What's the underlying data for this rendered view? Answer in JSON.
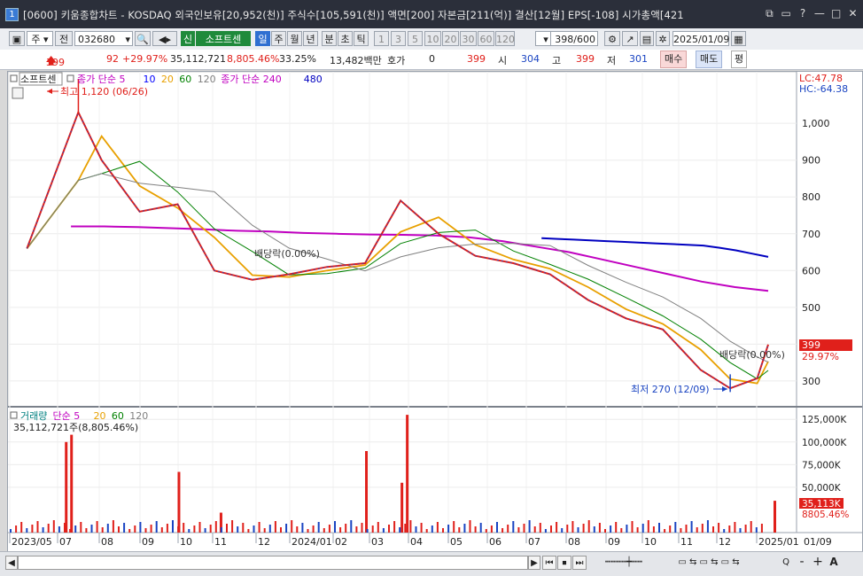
{
  "window": {
    "title": "[0600] 키움종합차트 - KOSDAQ 외국인보유[20,952(천)] 주식수[105,591(천)] 액면[200] 자본금[211(억)] 결산[12월] EPS[-108] 시가총액[421",
    "app_icon": "1"
  },
  "toolbar": {
    "period_label": "주",
    "prev_label": "전",
    "code": "032680",
    "badge": "신",
    "stock_name": "소프트센",
    "tabs": [
      "일",
      "주",
      "월",
      "년"
    ],
    "active_tab": "일",
    "intraday": [
      "분",
      "초",
      "틱"
    ],
    "intervals": [
      "1",
      "3",
      "5",
      "10",
      "20",
      "30",
      "60",
      "120"
    ],
    "bar_count": "398",
    "bar_total": "/600",
    "date": "2025/01/09"
  },
  "quote": {
    "price": "399",
    "change": "92",
    "change_pct": "+29.97%",
    "volume": "35,112,721",
    "vol_pct": "8,805.46%",
    "turnover_pct": "33.25%",
    "amount": "13,482백만",
    "hoga_label": "호가",
    "hoga_value": "0",
    "hoga_price": "399",
    "open_label": "시",
    "open": "304",
    "high_label": "고",
    "high": "399",
    "low_label": "저",
    "low": "301",
    "buy_label": "매수",
    "sell_label": "매도",
    "flat_label": "평"
  },
  "price_panel": {
    "stock_tag": "소프트센",
    "legend": [
      {
        "text": "종가 단순 5",
        "color": "#c000c0"
      },
      {
        "text": "10",
        "color": "#0000ff"
      },
      {
        "text": "20",
        "color": "#e8a000"
      },
      {
        "text": "60",
        "color": "#008000"
      },
      {
        "text": "120",
        "color": "#808080"
      },
      {
        "text": "종가 단순 240",
        "color": "#c000c0"
      },
      {
        "text": "480",
        "color": "#0000c0"
      }
    ],
    "lc_label": "LC:47.78",
    "hc_label": "HC:-64.38",
    "max_annotation": "최고 1,120 (06/26)",
    "min_annotation": "최저 270 (12/09)",
    "dividend_label_1": "배당락(0.00%)",
    "dividend_label_2": "배당락(0.00%)",
    "last_price_tag": "399",
    "last_change_tag": "29.97%"
  },
  "volume_panel": {
    "legend": [
      {
        "text": "거래량",
        "color": "#008080"
      },
      {
        "text": "단순 5",
        "color": "#c000c0"
      },
      {
        "text": "20",
        "color": "#e8a000"
      },
      {
        "text": "60",
        "color": "#008000"
      },
      {
        "text": "120",
        "color": "#808080"
      }
    ],
    "current_volume": "35,112,721주(8,805.46%)",
    "last_volume_tag": "35,113K",
    "last_ratio_tag": "8805.46%"
  },
  "chart_data": [
    {
      "type": "candlestick",
      "title": "",
      "y_ticks": [
        300,
        400,
        500,
        600,
        700,
        800,
        900,
        1000
      ],
      "y_tick_labels": [
        "300",
        "400",
        "500",
        "600",
        "700",
        "800",
        "900",
        "1,000"
      ],
      "ylim": [
        230,
        1140
      ],
      "x_labels": [
        "2023/05",
        "07",
        "08",
        "09",
        "10",
        "11",
        "12",
        "2024/01",
        "02",
        "03",
        "04",
        "05",
        "06",
        "07",
        "08",
        "09",
        "10",
        "11",
        "12",
        "2025/01",
        "01/09"
      ],
      "close_trend": [
        {
          "date": "2023-05",
          "value": 660
        },
        {
          "date": "2023-06-26",
          "value": 1030
        },
        {
          "date": "2023-07",
          "value": 900
        },
        {
          "date": "2023-08",
          "value": 760
        },
        {
          "date": "2023-09",
          "value": 780
        },
        {
          "date": "2023-10",
          "value": 600
        },
        {
          "date": "2023-11",
          "value": 575
        },
        {
          "date": "2023-12",
          "value": 590
        },
        {
          "date": "2024-01",
          "value": 610
        },
        {
          "date": "2024-02",
          "value": 620
        },
        {
          "date": "2024-03",
          "value": 790
        },
        {
          "date": "2024-04",
          "value": 700
        },
        {
          "date": "2024-05",
          "value": 640
        },
        {
          "date": "2024-06",
          "value": 620
        },
        {
          "date": "2024-07",
          "value": 590
        },
        {
          "date": "2024-08",
          "value": 520
        },
        {
          "date": "2024-09",
          "value": 470
        },
        {
          "date": "2024-10",
          "value": 440
        },
        {
          "date": "2024-11",
          "value": 330
        },
        {
          "date": "2024-12-09",
          "value": 280
        },
        {
          "date": "2024-12-31",
          "value": 307
        },
        {
          "date": "2025-01-09",
          "value": 399
        }
      ],
      "series": [
        {
          "name": "240",
          "values": [
            720,
            720,
            718,
            715,
            712,
            708,
            706,
            702,
            700,
            698,
            697,
            695,
            690,
            680,
            665,
            650,
            630,
            610,
            590,
            570,
            555,
            545
          ]
        },
        {
          "name": "480",
          "values": [
            688,
            686,
            684,
            682,
            680,
            678,
            676,
            674,
            672,
            670,
            668,
            662,
            655,
            646,
            637
          ]
        }
      ],
      "max_point": {
        "date": "2023-06-26",
        "value": 1120
      },
      "min_point": {
        "date": "2024-12-09",
        "value": 270
      }
    },
    {
      "type": "bar",
      "title": "",
      "y_ticks": [
        50000,
        75000,
        100000,
        125000
      ],
      "y_tick_labels": [
        "50,000K",
        "75,000K",
        "100,000K",
        "125,000K"
      ],
      "ylim": [
        0,
        135000
      ],
      "unit": "K",
      "spikes": [
        {
          "date": "2023-06",
          "value": 100000
        },
        {
          "date": "2023-06",
          "value": 108000
        },
        {
          "date": "2023-09",
          "value": 67000
        },
        {
          "date": "2023-10",
          "value": 22000
        },
        {
          "date": "2024-02",
          "value": 90000
        },
        {
          "date": "2024-03",
          "value": 130000
        },
        {
          "date": "2024-03",
          "value": 55000
        },
        {
          "date": "2025-01-09",
          "value": 35113
        }
      ]
    }
  ],
  "bottom": {
    "labels": [
      "◀",
      "▶",
      "⏮",
      "⏹",
      "⏭",
      "Q",
      "-",
      "+",
      "A"
    ]
  }
}
